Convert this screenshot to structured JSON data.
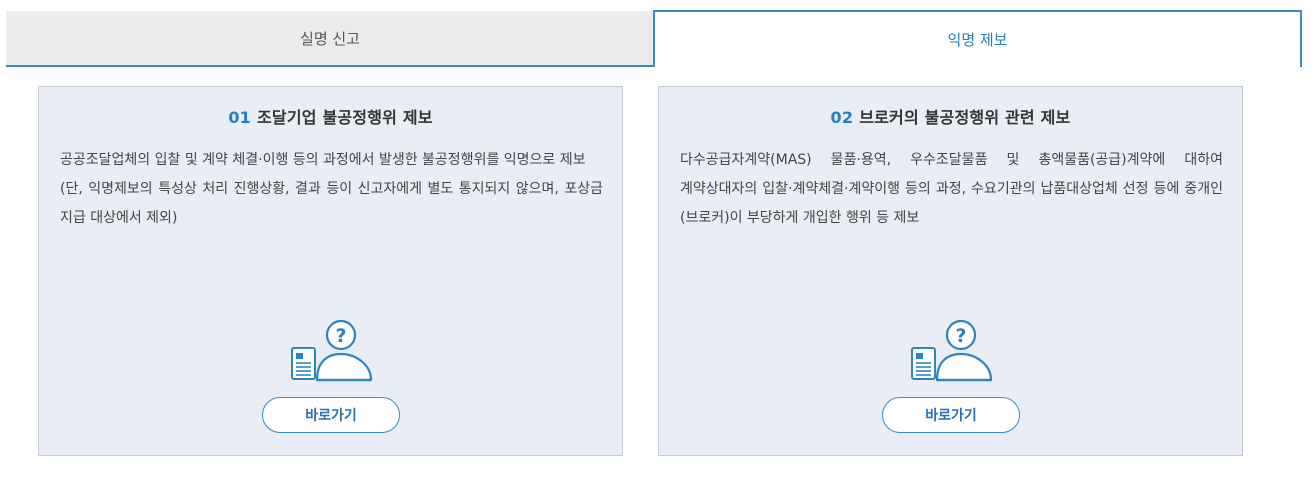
{
  "tabs": [
    {
      "label": "실명 신고",
      "active": false
    },
    {
      "label": "익명 제보",
      "active": true
    }
  ],
  "cards": [
    {
      "number": "01",
      "title": "조달기업 불공정행위 제보",
      "description": [
        "공공조달업체의 입찰 및 계약 체결·이행 등의 과정에서 발생한 불공정행위를 익명으로 제보",
        "(단, 익명제보의 특성상 처리 진행상황, 결과 등이 신고자에게 별도 통지되지 않으며, 포상금 지급 대상에서 제외)"
      ],
      "icon": "anonymous-report-icon",
      "button_label": "바로가기"
    },
    {
      "number": "02",
      "title": "브로커의 불공정행위 관련 제보",
      "description": [
        "다수공급자계약(MAS) 물품·용역, 우수조달물품 및 총액물품(공급)계약에 대하여 계약상대자의 입찰·계약체결·계약이행 등의 과정, 수요기관의 납품대상업체 선정 등에 중개인(브로커)이 부당하게 개입한 행위 등 제보"
      ],
      "icon": "anonymous-report-icon",
      "button_label": "바로가기"
    }
  ],
  "colors": {
    "accent": "#2a7dbf",
    "tab_border": "#3a8ac4",
    "card_bg": "#e9edf5",
    "inactive_tab_bg": "#ececec"
  }
}
